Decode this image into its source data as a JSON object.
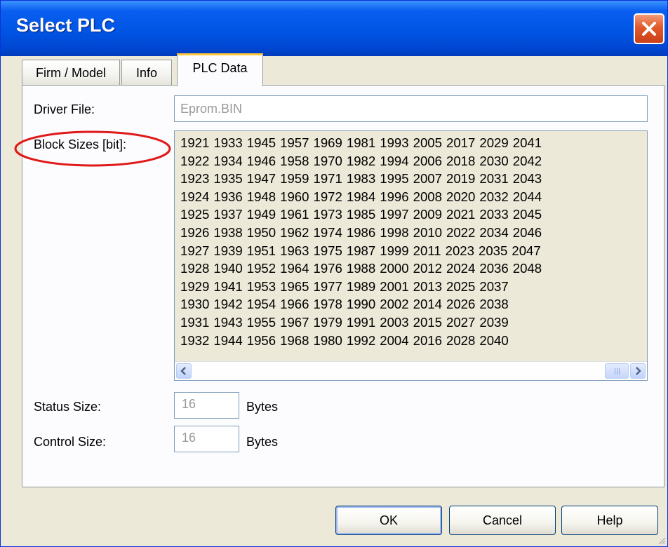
{
  "window": {
    "title": "Select PLC",
    "close_label": "✕"
  },
  "tabs": [
    {
      "label": "Firm / Model"
    },
    {
      "label": "Info"
    },
    {
      "label": "PLC Data",
      "selected": true
    }
  ],
  "form": {
    "driver_file_label": "Driver File:",
    "driver_file_value": "Eprom.BIN",
    "block_sizes_label": "Block Sizes [bit]:",
    "block_rows": [
      [
        "1921",
        "1933",
        "1945",
        "1957",
        "1969",
        "1981",
        "1993",
        "2005",
        "2017",
        "2029",
        "2041"
      ],
      [
        "1922",
        "1934",
        "1946",
        "1958",
        "1970",
        "1982",
        "1994",
        "2006",
        "2018",
        "2030",
        "2042"
      ],
      [
        "1923",
        "1935",
        "1947",
        "1959",
        "1971",
        "1983",
        "1995",
        "2007",
        "2019",
        "2031",
        "2043"
      ],
      [
        "1924",
        "1936",
        "1948",
        "1960",
        "1972",
        "1984",
        "1996",
        "2008",
        "2020",
        "2032",
        "2044"
      ],
      [
        "1925",
        "1937",
        "1949",
        "1961",
        "1973",
        "1985",
        "1997",
        "2009",
        "2021",
        "2033",
        "2045"
      ],
      [
        "1926",
        "1938",
        "1950",
        "1962",
        "1974",
        "1986",
        "1998",
        "2010",
        "2022",
        "2034",
        "2046"
      ],
      [
        "1927",
        "1939",
        "1951",
        "1963",
        "1975",
        "1987",
        "1999",
        "2011",
        "2023",
        "2035",
        "2047"
      ],
      [
        "1928",
        "1940",
        "1952",
        "1964",
        "1976",
        "1988",
        "2000",
        "2012",
        "2024",
        "2036",
        "2048"
      ],
      [
        "1929",
        "1941",
        "1953",
        "1965",
        "1977",
        "1989",
        "2001",
        "2013",
        "2025",
        "2037"
      ],
      [
        "1930",
        "1942",
        "1954",
        "1966",
        "1978",
        "1990",
        "2002",
        "2014",
        "2026",
        "2038"
      ],
      [
        "1931",
        "1943",
        "1955",
        "1967",
        "1979",
        "1991",
        "2003",
        "2015",
        "2027",
        "2039"
      ],
      [
        "1932",
        "1944",
        "1956",
        "1968",
        "1980",
        "1992",
        "2004",
        "2016",
        "2028",
        "2040"
      ]
    ],
    "status_size_label": "Status Size:",
    "status_size_value": "16",
    "status_unit": "Bytes",
    "control_size_label": "Control Size:",
    "control_size_value": "16",
    "control_unit": "Bytes"
  },
  "buttons": {
    "ok": "OK",
    "cancel": "Cancel",
    "help": "Help"
  },
  "colors": {
    "dialog_bg": "#ece9d8",
    "titlebar": "#0055e5",
    "highlight_ellipse": "#e01818",
    "disabled_text": "#9a9a9a"
  }
}
